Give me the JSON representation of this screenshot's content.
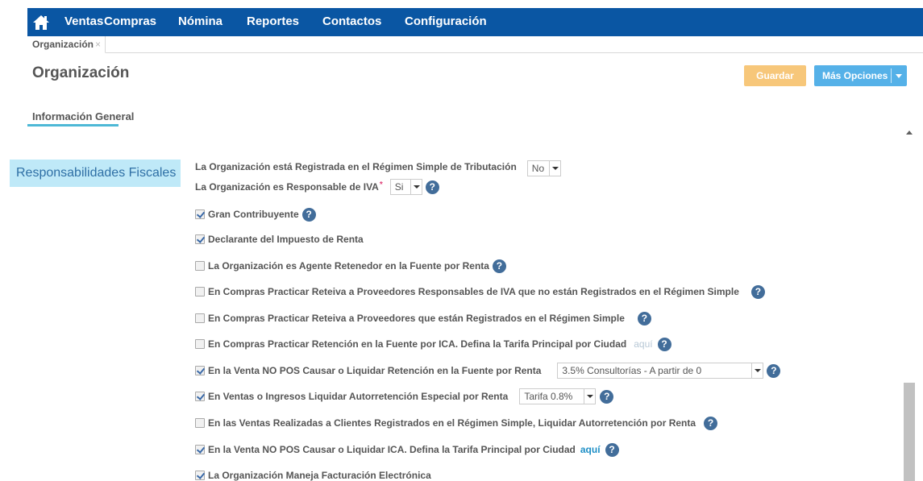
{
  "nav": {
    "items": [
      "Ventas",
      "Compras",
      "Nómina",
      "Reportes",
      "Contactos",
      "Configuración"
    ]
  },
  "tab": {
    "label": "Organización",
    "close": "×"
  },
  "header": {
    "title": "Organización",
    "save_label": "Guardar",
    "more_label": "Más Opciones"
  },
  "section_tab": "Información General",
  "section_label": "Responsabilidades Fiscales",
  "fields": {
    "simple_regime_label": "La Organización está Registrada en el Régimen Simple de Tributación",
    "simple_regime_value": "No",
    "iva_label": "La Organización es Responsable de IVA",
    "iva_required": "*",
    "iva_value": "Si"
  },
  "checks": [
    {
      "label": "Gran Contribuyente",
      "checked": true,
      "help": true
    },
    {
      "label": "Declarante del Impuesto de Renta",
      "checked": true,
      "help": false
    },
    {
      "label": "La Organización es Agente Retenedor en la Fuente por Renta",
      "checked": false,
      "help": true
    },
    {
      "label": "En Compras Practicar Reteiva a Proveedores Responsables de IVA que no están Registrados en el Régimen Simple",
      "checked": false,
      "help": true
    },
    {
      "label": "En Compras Practicar Reteiva a Proveedores que están Registrados en el Régimen Simple",
      "checked": false,
      "help": true
    },
    {
      "label": "En Compras Practicar Retención en la Fuente por ICA. Defina la Tarifa Principal por Ciudad",
      "checked": false,
      "help": true,
      "link": "aquí"
    },
    {
      "label": "En la Venta NO POS Causar o Liquidar Retención en la Fuente por Renta",
      "checked": true,
      "help": true,
      "select": "3.5% Consultorías - A partir de 0"
    },
    {
      "label": "En Ventas o Ingresos Liquidar Autorretención Especial por Renta",
      "checked": true,
      "help": true,
      "select": "Tarifa 0.8%"
    },
    {
      "label": "En las Ventas Realizadas a Clientes Registrados en el Régimen Simple, Liquidar Autorretención por Renta",
      "checked": false,
      "help": true
    },
    {
      "label": "En la Venta NO POS Causar o Liquidar ICA. Defina la Tarifa Principal por Ciudad",
      "checked": true,
      "help": true,
      "link": "aquí"
    },
    {
      "label": "La Organización Maneja Facturación Electrónica",
      "checked": true,
      "help": false
    }
  ],
  "help_glyph": "?",
  "icons": {
    "home": "home-icon",
    "help": "question-circle-icon",
    "caret": "caret-down-icon"
  },
  "colors": {
    "nav_bg": "#0a56a3",
    "save_bg": "#f7c77a",
    "more_bg": "#55b1e8",
    "section_bg": "#bfe9f8",
    "tab_underline": "#4db8d6",
    "help_bg": "#426d9a",
    "link": "#1e8fc6"
  }
}
